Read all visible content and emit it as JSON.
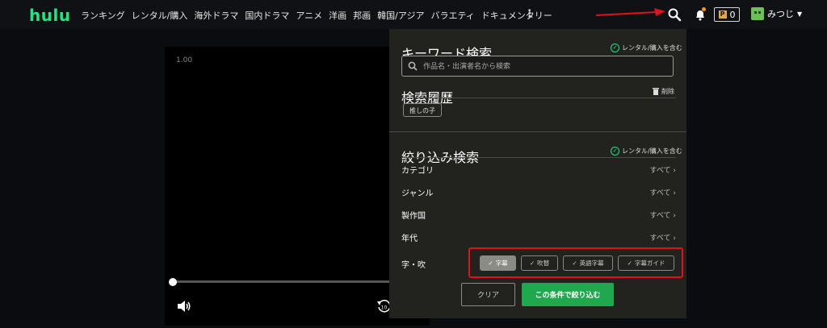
{
  "header": {
    "logo": "hulu",
    "nav": [
      "ランキング",
      "レンタル/購入",
      "海外ドラマ",
      "国内ドラマ",
      "アニメ",
      "洋画",
      "邦画",
      "韓国/アジア",
      "バラエティ",
      "ドキュメンタリー"
    ],
    "points_label": "P",
    "points_count": "0",
    "username": "みつじ"
  },
  "player": {
    "speed": "1.00",
    "rewind_seconds": "10"
  },
  "search": {
    "keyword_title": "キーワード検索",
    "include_rental": "レンタル/購入を含む",
    "placeholder": "作品名・出演者名から検索",
    "history_title": "検索履歴",
    "delete_label": "削除",
    "history_items": [
      "推しの子"
    ],
    "filter_title": "絞り込み検索",
    "filter_include_rental": "レンタル/購入を含む",
    "rows": [
      {
        "label": "カテゴリ",
        "value": "すべて"
      },
      {
        "label": "ジャンル",
        "value": "すべて"
      },
      {
        "label": "製作国",
        "value": "すべて"
      },
      {
        "label": "年代",
        "value": "すべて"
      }
    ],
    "subtitle_label": "字・吹",
    "subtitle_options": [
      {
        "label": "字幕",
        "selected": true
      },
      {
        "label": "吹替",
        "selected": false
      },
      {
        "label": "英語字幕",
        "selected": false
      },
      {
        "label": "字幕ガイド",
        "selected": false
      }
    ],
    "clear_label": "クリア",
    "apply_label": "この条件で絞り込む"
  },
  "colors": {
    "brand": "#1ce783",
    "apply": "#1fa84d",
    "highlight": "#e0131b",
    "points": "#e8a73b"
  }
}
